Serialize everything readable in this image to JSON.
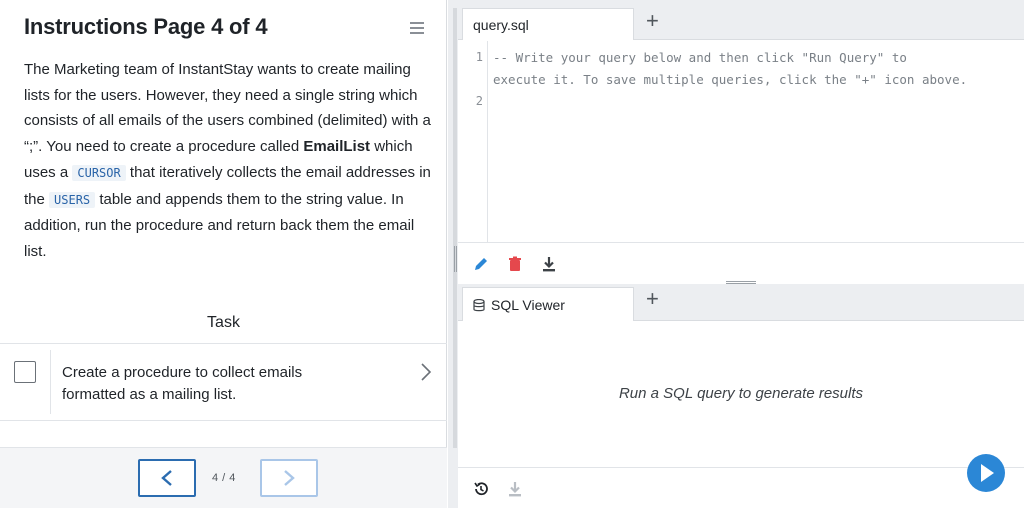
{
  "instructions": {
    "title": "Instructions Page 4 of 4",
    "desc": {
      "p1": "The Marketing team of InstantStay wants to create mailing lists for the users. However, they need a single string which consists of all emails of the users combined (delimited) with a “;”. You need to create a procedure called ",
      "proc_name": "EmailList",
      "p2": " which uses a ",
      "code1": "CURSOR",
      "p3": " that iteratively collects the email addresses in the ",
      "code2": "USERS",
      "p4": " table and appends them to the string value. In addition, run the procedure and return back them the email list."
    },
    "task_heading": "Task",
    "task_text": "Create a procedure to collect emails formatted as a mailing list.",
    "pager": {
      "count": "4 / 4"
    }
  },
  "editor": {
    "tab_label": "query.sql",
    "lines": [
      {
        "num": "1",
        "text": "-- Write your query below and then click \"Run Query\" to"
      },
      {
        "num": "",
        "text": "execute it. To save multiple queries, click the \"+\" icon above."
      },
      {
        "num": "2",
        "text": ""
      }
    ]
  },
  "viewer": {
    "tab_label": "SQL Viewer",
    "empty_message": "Run a SQL query to generate results"
  },
  "colors": {
    "accent": "#2b87d6",
    "delete": "#e5484d",
    "code_text": "#2a64a8"
  },
  "icons": [
    "menu-icon",
    "checkbox-icon",
    "chevron-right-icon",
    "chevron-left-icon",
    "plus-icon",
    "database-icon",
    "pencil-icon",
    "trash-icon",
    "download-icon",
    "history-icon",
    "play-icon"
  ]
}
